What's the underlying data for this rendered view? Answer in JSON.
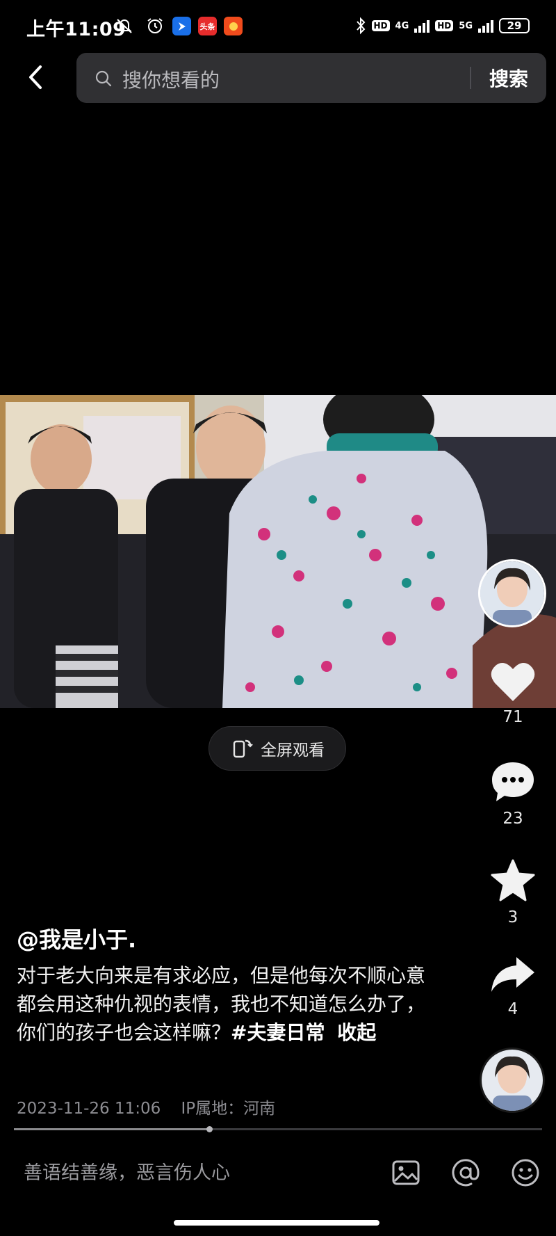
{
  "status_bar": {
    "time": "上午11:09",
    "app_badges": [
      "头条"
    ],
    "network_left": "4G",
    "network_right": "5G",
    "battery": "29"
  },
  "search": {
    "placeholder": "搜你想看的",
    "button_label": "搜索"
  },
  "video": {
    "fullscreen_label": "全屏观看"
  },
  "actions": {
    "likes": "71",
    "comments": "23",
    "favorites": "3",
    "shares": "4"
  },
  "post": {
    "author": "@我是小于.",
    "caption_text": "对于老大向来是有求必应，但是他每次不顺心意都会用这种仇视的表情，我也不知道怎么办了，你们的孩子也会这样嘛？",
    "hashtag": "#夫妻日常",
    "collapse_label": "收起",
    "date": "2023-11-26 11:06",
    "ip_location": "IP属地：河南"
  },
  "progress": {
    "fraction": 0.37
  },
  "comment_bar": {
    "placeholder": "善语结善缘，恶言伤人心"
  }
}
